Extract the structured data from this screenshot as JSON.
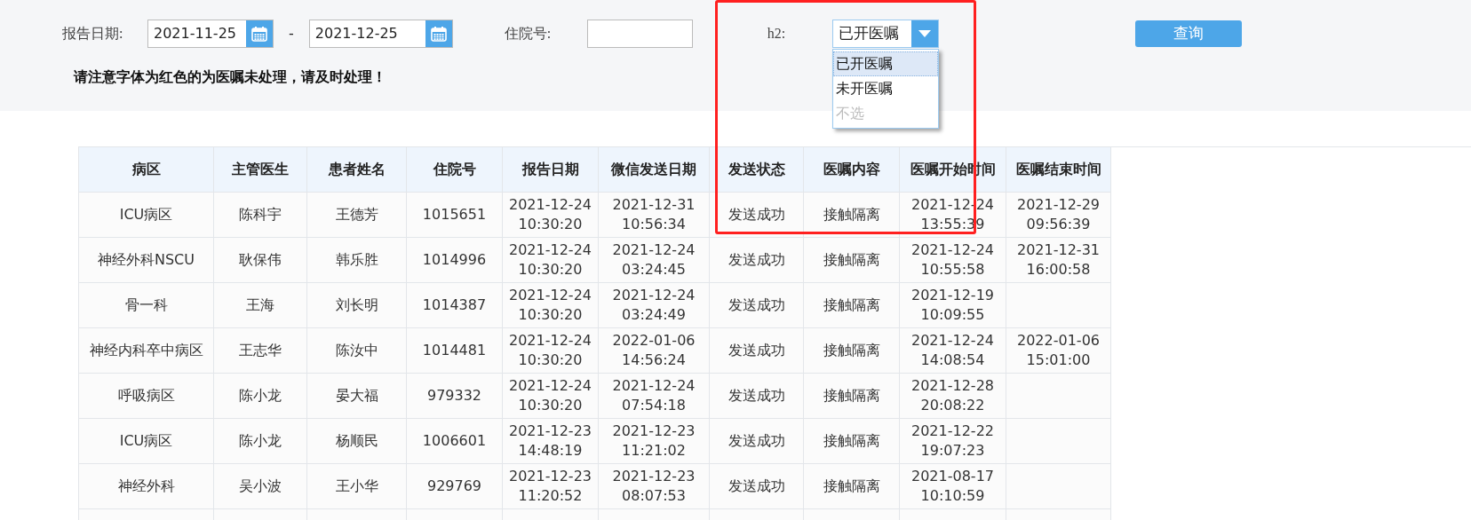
{
  "filters": {
    "report_date_label": "报告日期:",
    "date_from": "2021-11-25",
    "date_separator": "-",
    "date_to": "2021-12-25",
    "admission_no_label": "住院号:",
    "h2_label": "h2:",
    "h2_value": "已开医嘱",
    "h2_options": [
      {
        "label": "已开医嘱",
        "selected": true,
        "disabled": false
      },
      {
        "label": "未开医嘱",
        "selected": false,
        "disabled": false
      },
      {
        "label": "不选",
        "selected": false,
        "disabled": true
      }
    ],
    "query_button": "查询"
  },
  "notice": "请注意字体为红色的为医嘱未处理，请及时处理！",
  "table": {
    "columns": [
      "病区",
      "主管医生",
      "患者姓名",
      "住院号",
      "报告日期",
      "微信发送日期",
      "发送状态",
      "医嘱内容",
      "医嘱开始时间",
      "医嘱结束时间"
    ],
    "rows": [
      [
        "ICU病区",
        "陈科宇",
        "王德芳",
        "1015651",
        "2021-12-24\n10:30:20",
        "2021-12-31\n10:56:34",
        "发送成功",
        "接触隔离",
        "2021-12-24\n13:55:39",
        "2021-12-29\n09:56:39"
      ],
      [
        "神经外科NSCU",
        "耿保伟",
        "韩乐胜",
        "1014996",
        "2021-12-24\n10:30:20",
        "2021-12-24\n03:24:45",
        "发送成功",
        "接触隔离",
        "2021-12-24\n10:55:58",
        "2021-12-31\n16:00:58"
      ],
      [
        "骨一科",
        "王海",
        "刘长明",
        "1014387",
        "2021-12-24\n10:30:20",
        "2021-12-24\n03:24:49",
        "发送成功",
        "接触隔离",
        "2021-12-19\n10:09:55",
        ""
      ],
      [
        "神经内科卒中病区",
        "王志华",
        "陈汝中",
        "1014481",
        "2021-12-24\n10:30:20",
        "2022-01-06\n14:56:24",
        "发送成功",
        "接触隔离",
        "2021-12-24\n14:08:54",
        "2022-01-06\n15:01:00"
      ],
      [
        "呼吸病区",
        "陈小龙",
        "晏大福",
        "979332",
        "2021-12-24\n10:30:20",
        "2021-12-24\n07:54:18",
        "发送成功",
        "接触隔离",
        "2021-12-28\n20:08:22",
        ""
      ],
      [
        "ICU病区",
        "陈小龙",
        "杨顺民",
        "1006601",
        "2021-12-23\n14:48:19",
        "2021-12-23\n11:21:02",
        "发送成功",
        "接触隔离",
        "2021-12-22\n19:07:23",
        ""
      ],
      [
        "神经外科",
        "吴小波",
        "王小华",
        "929769",
        "2021-12-23\n11:20:52",
        "2021-12-23\n08:07:53",
        "发送成功",
        "接触隔离",
        "2021-08-17\n10:10:59",
        ""
      ]
    ]
  }
}
